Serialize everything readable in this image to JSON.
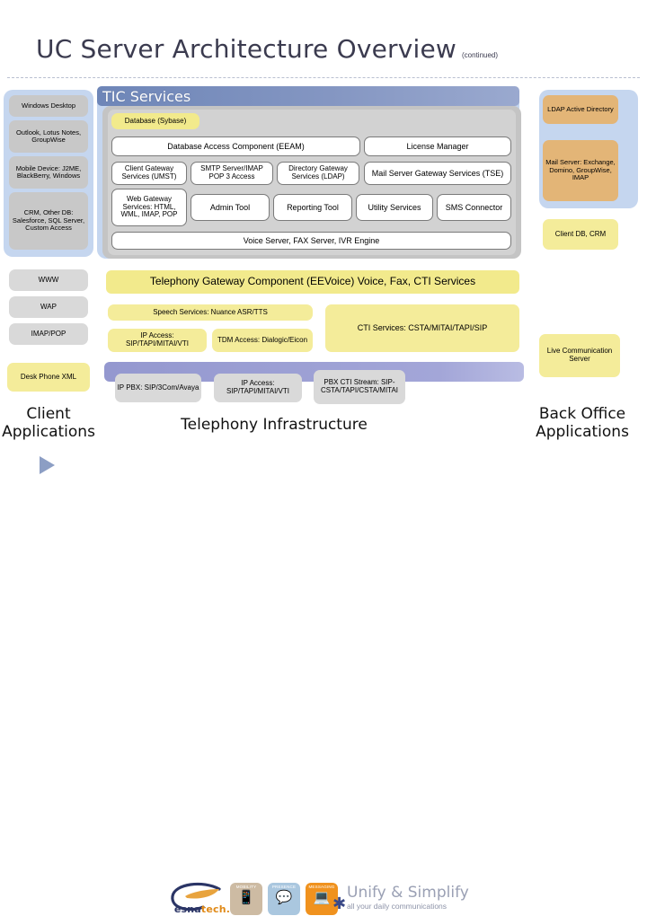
{
  "title": {
    "main": "UC Server Architecture Overview",
    "sub": "(continued)"
  },
  "colors": {
    "header_bar": "#6e86b8",
    "panel_blue": "#96b4e1",
    "gray_box": "#c8c8c8",
    "yellow_box": "#f2ea8c",
    "tan_box": "#e3b577",
    "purple_bar": "#9498cf",
    "white_box": "#ffffff",
    "title_text": "#3b3b4f"
  },
  "tic": {
    "header": "TIC Services",
    "database": "Database (Sybase)",
    "row_access": [
      "Database Access Component (EEAM)",
      "License Manager"
    ],
    "row_gateways": [
      "Client Gateway Services (UMST)",
      "SMTP Server/IMAP POP 3 Access",
      "Directory Gateway Services (LDAP)",
      "Mail Server Gateway Services (TSE)"
    ],
    "row_tools": [
      "Web Gateway Services: HTML, WML, IMAP, POP",
      "Admin Tool",
      "Reporting Tool",
      "Utility Services",
      "SMS Connector"
    ],
    "footer_bar": "Voice Server, FAX Server, IVR Engine"
  },
  "left_sidebar": {
    "label": "Client Applications",
    "clients": [
      "Windows Desktop",
      "Outlook, Lotus Notes, GroupWise",
      "Mobile Device: J2ME, BlackBerry, Windows",
      "CRM, Other DB: Salesforce, SQL Server, Custom Access"
    ],
    "protocols": [
      "WWW",
      "WAP",
      "IMAP/POP"
    ],
    "phone": "Desk Phone XML"
  },
  "right_sidebar": {
    "label": "Back Office Applications",
    "items": [
      "LDAP Active Directory",
      "Mail Server: Exchange, Domino, GroupWise, IMAP",
      "Client DB, CRM",
      "Live Communication Server"
    ]
  },
  "telephony": {
    "label": "Telephony Infrastructure",
    "gateway_bar": "Telephony Gateway Component (EEVoice) Voice, Fax, CTI Services",
    "speech": "Speech Services: Nuance ASR/TTS",
    "ip_access": "IP Access: SIP/TAPI/MITAI/VTI",
    "tdm_access": "TDM Access: Dialogic/Eicon",
    "cti_services": "CTI Services: CSTA/MITAI/TAPI/SIP",
    "pbx": [
      "IP PBX: SIP/3Com/Avaya",
      "IP Access: SIP/TAPI/MITAI/VTI",
      "PBX CTI Stream: SIP-CSTA/TAPI/CSTA/MITAI"
    ]
  },
  "footer": {
    "brand_part1": "esna",
    "brand_part2": "tech.",
    "tiles": [
      {
        "caption": "MOBILITY",
        "glyph": "📱"
      },
      {
        "caption": "PRESENCE",
        "glyph": "💬"
      },
      {
        "caption": "MESSAGING",
        "glyph": "💻"
      }
    ],
    "tagline_main": "Unify & Simplify",
    "tagline_sub": "all your daily communications"
  }
}
